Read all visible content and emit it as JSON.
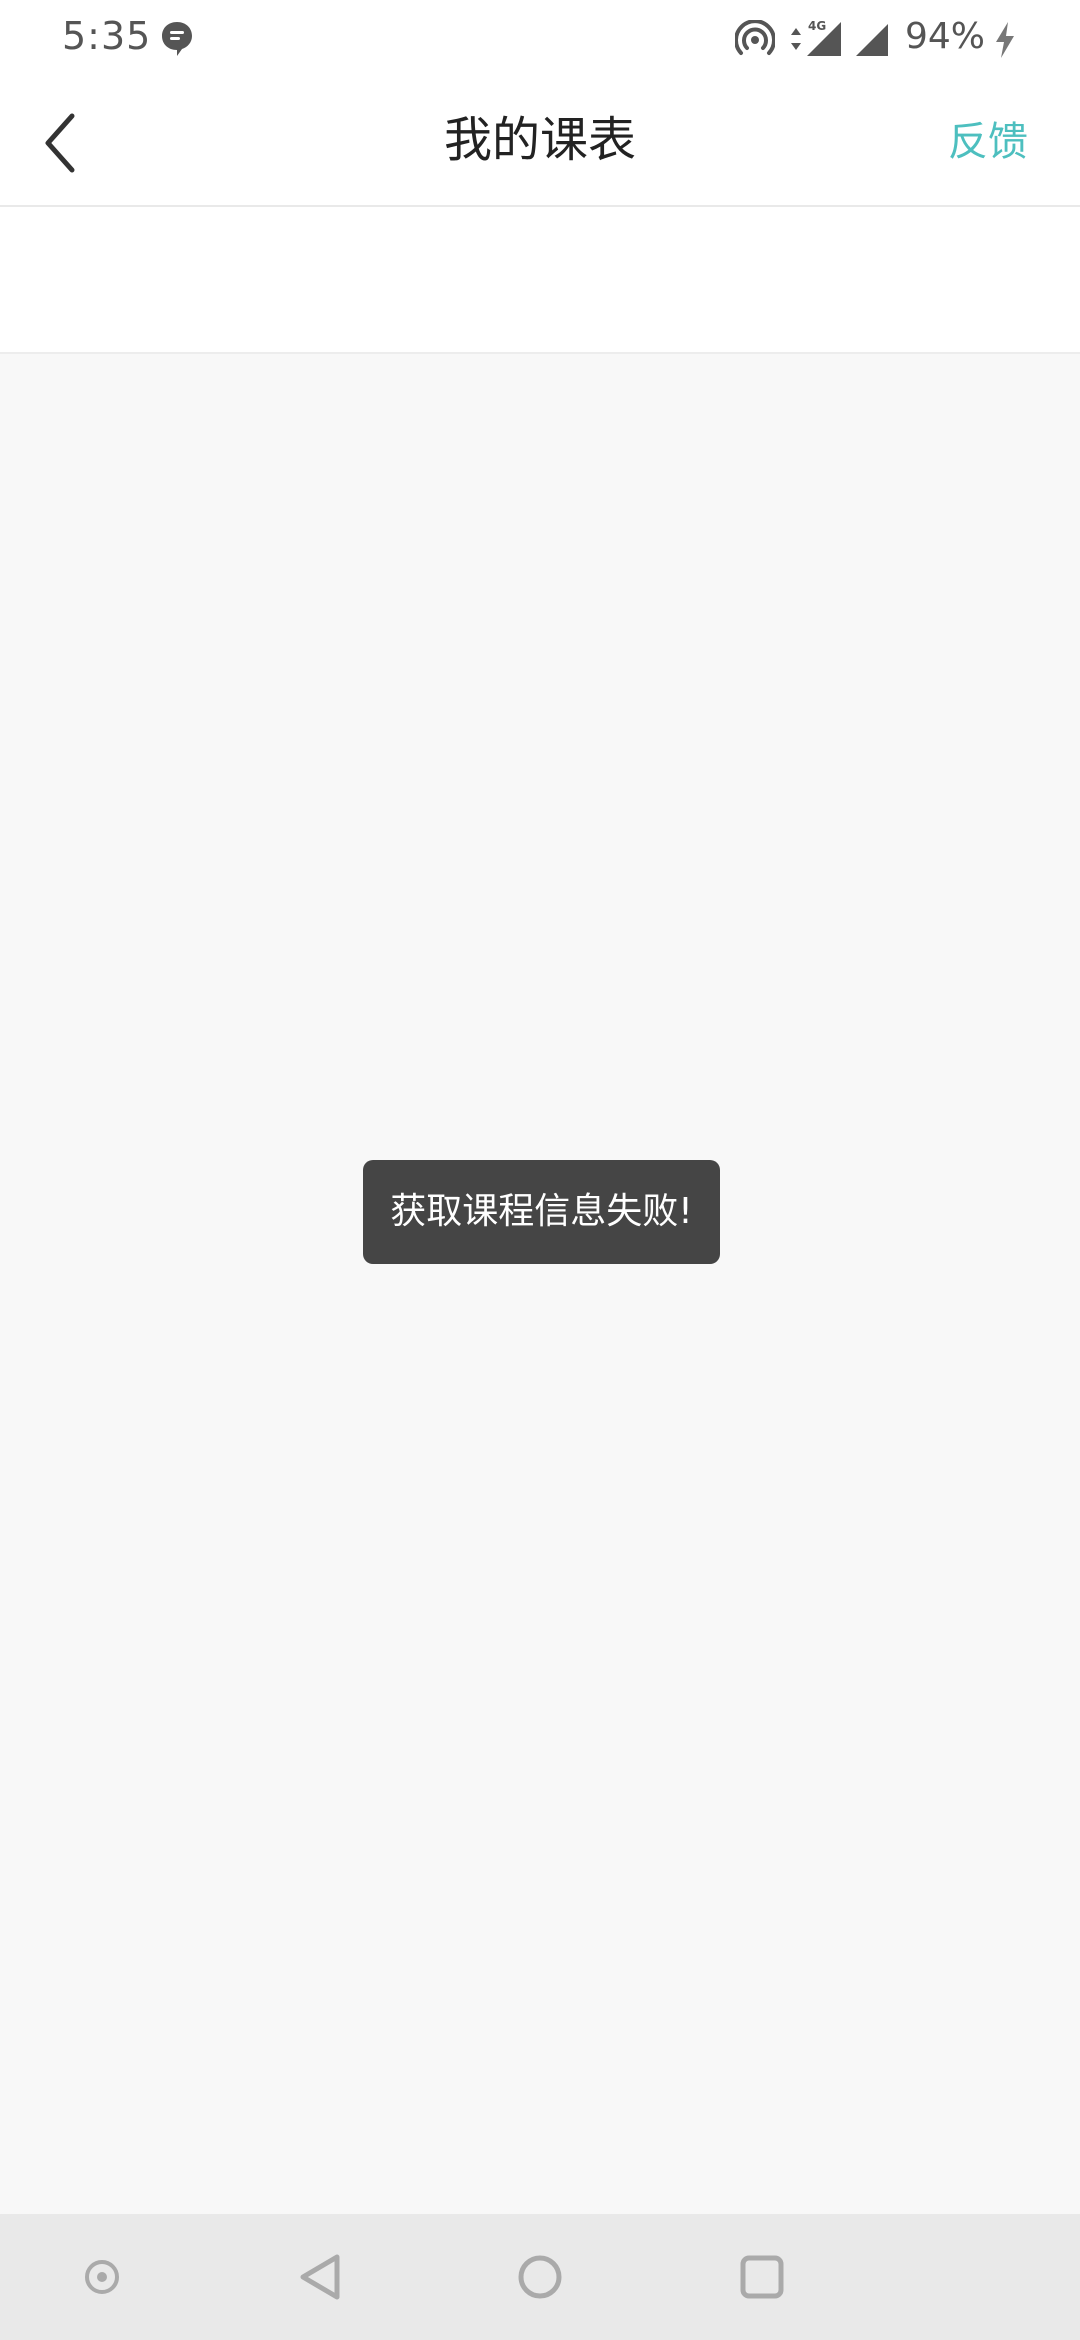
{
  "status_bar": {
    "time": "5:35",
    "battery": "94%",
    "network": "4G",
    "icons": [
      "message-icon",
      "hotspot-icon",
      "data-arrows-icon",
      "signal-icon",
      "signal-icon",
      "charging-bolt-icon"
    ]
  },
  "header": {
    "title": "我的课表",
    "feedback_label": "反馈",
    "back_icon": "chevron-left-icon"
  },
  "toast": {
    "message": "获取课程信息失败!"
  },
  "nav_bar": {
    "icons": [
      "assist-dot-icon",
      "back-triangle-icon",
      "home-circle-icon",
      "recent-square-icon"
    ]
  },
  "colors": {
    "accent": "#4dbfbf",
    "toast_bg": "#454545",
    "page_bg": "#f8f8f8",
    "nav_bg": "#e9e9e9"
  }
}
